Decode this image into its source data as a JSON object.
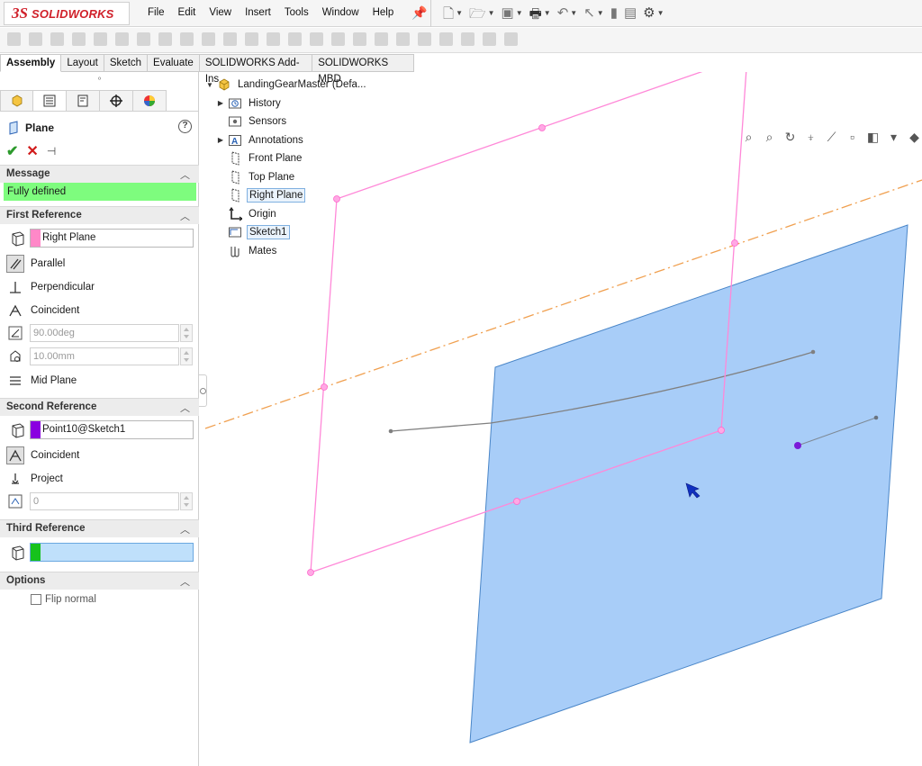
{
  "app": {
    "brand_ds": "3S",
    "brand_name": "SOLIDWORKS"
  },
  "menu": [
    "File",
    "Edit",
    "View",
    "Insert",
    "Tools",
    "Window",
    "Help"
  ],
  "command_tabs": [
    "Assembly",
    "Layout",
    "Sketch",
    "Evaluate",
    "SOLIDWORKS Add-Ins",
    "SOLIDWORKS MBD"
  ],
  "active_command_tab": "Assembly",
  "property_manager": {
    "title": "Plane",
    "help": "?",
    "sections": {
      "message": "Message",
      "first_reference": "First Reference",
      "second_reference": "Second Reference",
      "third_reference": "Third Reference",
      "options": "Options"
    },
    "message_text": "Fully defined",
    "first_reference": {
      "value": "Right Plane",
      "swatch_color": "#ff88c8",
      "options": [
        "Parallel",
        "Perpendicular",
        "Coincident"
      ],
      "angle_value": "90.00deg",
      "distance_value": "10.00mm",
      "mid_plane": "Mid Plane"
    },
    "second_reference": {
      "value": "Point10@Sketch1",
      "swatch_color": "#8a00e0",
      "options": [
        "Coincident",
        "Project"
      ],
      "count_value": "0"
    },
    "third_reference": {
      "value": "",
      "swatch_color": "#16c21c"
    },
    "flip_normal": "Flip normal"
  },
  "feature_tree": {
    "root": "LandingGearMaster  (Defa...",
    "items": [
      "History",
      "Sensors",
      "Annotations",
      "Front Plane",
      "Top Plane",
      "Right Plane",
      "Origin",
      "Sketch1",
      "Mates"
    ]
  },
  "colors": {
    "reference_plane": "#ff88d8",
    "preview_plane_fill": "#a8cdf8",
    "preview_plane_edge": "#4a86c8",
    "axis_line": "#f0a050",
    "sketch_line": "#888888"
  }
}
